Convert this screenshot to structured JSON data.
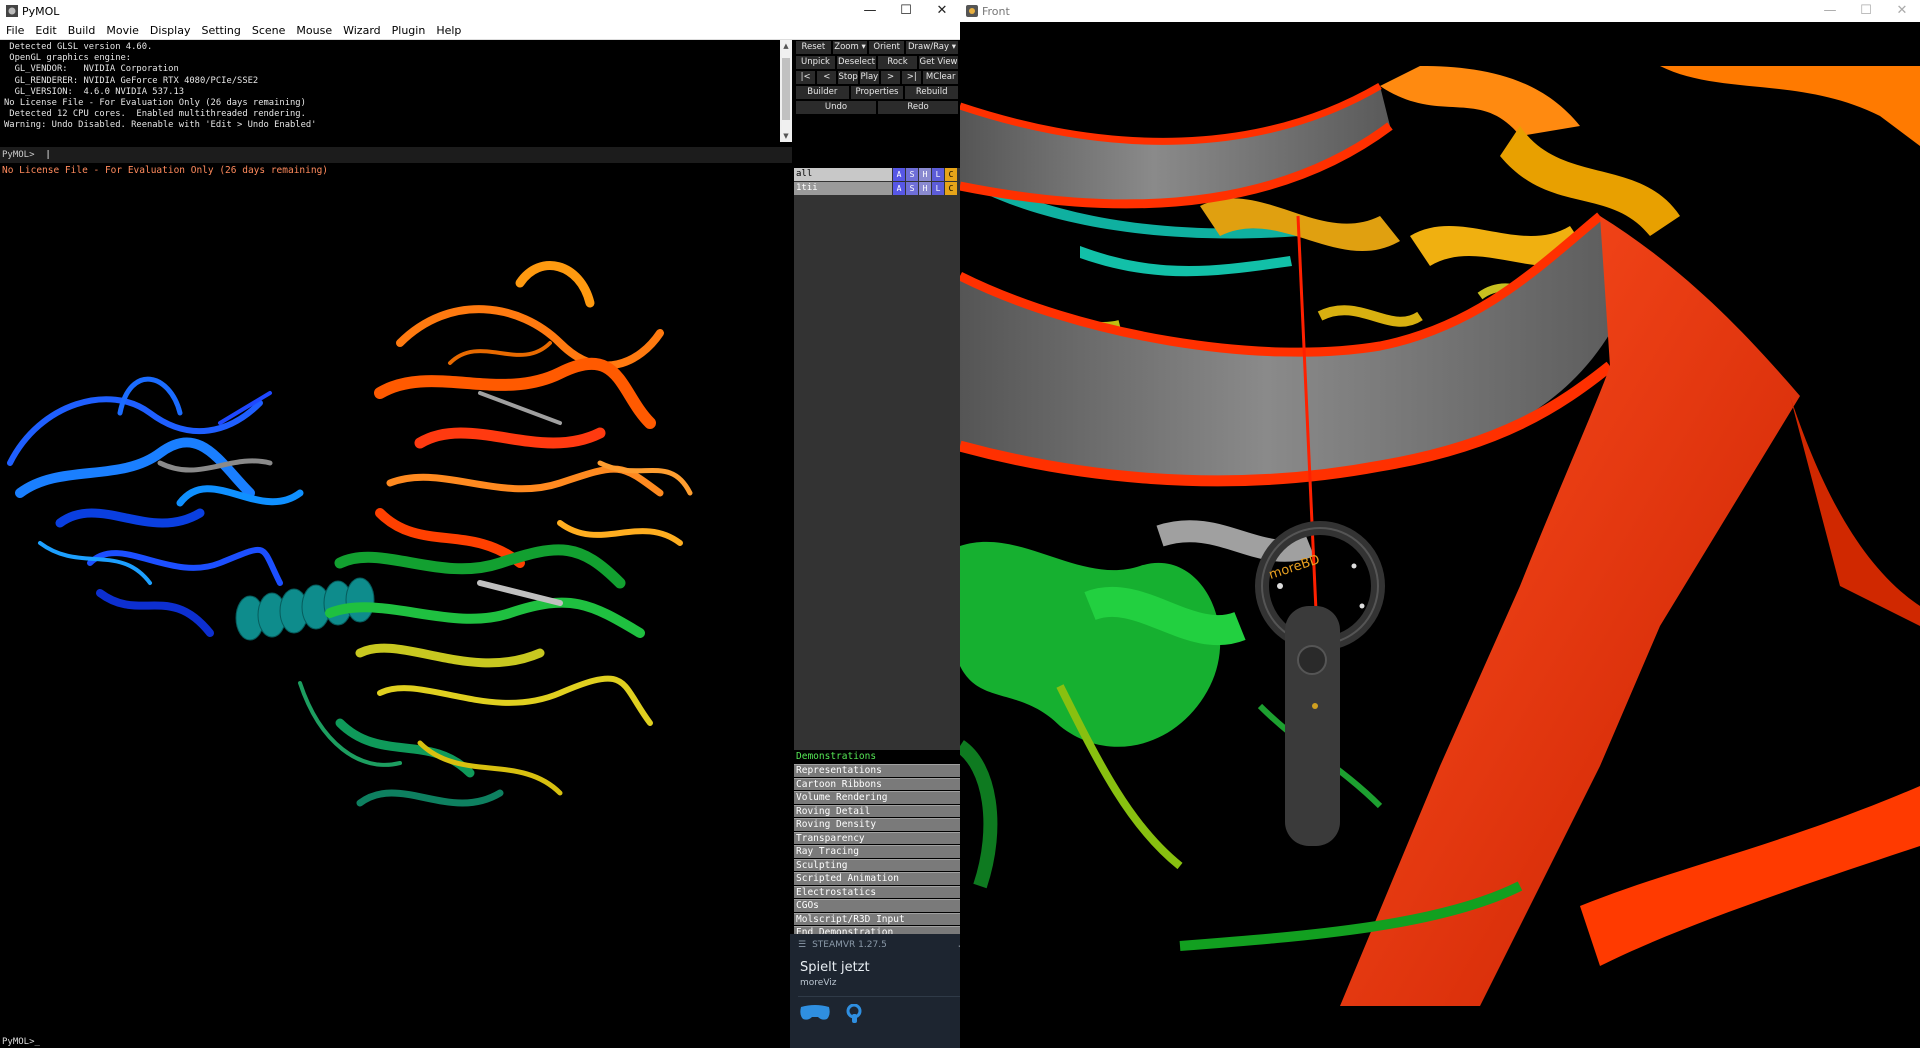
{
  "pymol_window": {
    "title": "PyMOL",
    "controls": [
      "—",
      "☐",
      "✕"
    ]
  },
  "menu": [
    "File",
    "Edit",
    "Build",
    "Movie",
    "Display",
    "Setting",
    "Scene",
    "Mouse",
    "Wizard",
    "Plugin",
    "Help"
  ],
  "console_lines": [
    " Detected GLSL version 4.60.",
    " OpenGL graphics engine:",
    "  GL_VENDOR:   NVIDIA Corporation",
    "  GL_RENDERER: NVIDIA GeForce RTX 4080/PCIe/SSE2",
    "  GL_VERSION:  4.6.0 NVIDIA 537.13",
    "No License File - For Evaluation Only (26 days remaining)",
    " Detected 12 CPU cores.  Enabled multithreaded rendering.",
    "Warning: Undo Disabled. Reenable with 'Edit > Undo Enabled'"
  ],
  "command_prompt": "PyMOL>",
  "license_note": "No License File - For Evaluation Only (26 days remaining)",
  "bottom_prompt": "PyMOL>_",
  "buttons": {
    "row1": [
      "Reset",
      "Zoom ▾",
      "Orient",
      "Draw/Ray ▾"
    ],
    "row2": [
      "Unpick",
      "Deselect",
      "Rock",
      "Get View"
    ],
    "row3": [
      "|<",
      "<",
      "Stop",
      "Play",
      ">",
      ">|",
      "MClear"
    ],
    "row4": [
      "Builder",
      "Properties",
      "Rebuild"
    ],
    "row5": [
      "Undo",
      "Redo"
    ]
  },
  "objects": [
    {
      "name": "all",
      "selected": false
    },
    {
      "name": "1tii",
      "selected": true
    }
  ],
  "object_buttons": [
    "A",
    "S",
    "H",
    "L",
    "C"
  ],
  "demos": {
    "header": "Demonstrations",
    "items": [
      "Representations",
      "Cartoon Ribbons",
      "Volume Rendering",
      "Roving Detail",
      "Roving Density",
      "Transparency",
      "Ray Tracing",
      "Sculpting",
      "Scripted Animation",
      "Electrostatics",
      "CGOs",
      "Molscript/R3D Input",
      "End Demonstration"
    ]
  },
  "steamvr": {
    "title": "STEAMVR 1.27.5",
    "status": "Spielt jetzt",
    "app": "moreViz"
  },
  "front_window": {
    "title": "Front",
    "controls": [
      "—",
      "☐",
      "✕"
    ]
  },
  "colors": {
    "accent_green": "#55e655",
    "license_orange": "#ff8a5c",
    "steam_bg": "#1d2530"
  },
  "controller_brand": "moreBD"
}
